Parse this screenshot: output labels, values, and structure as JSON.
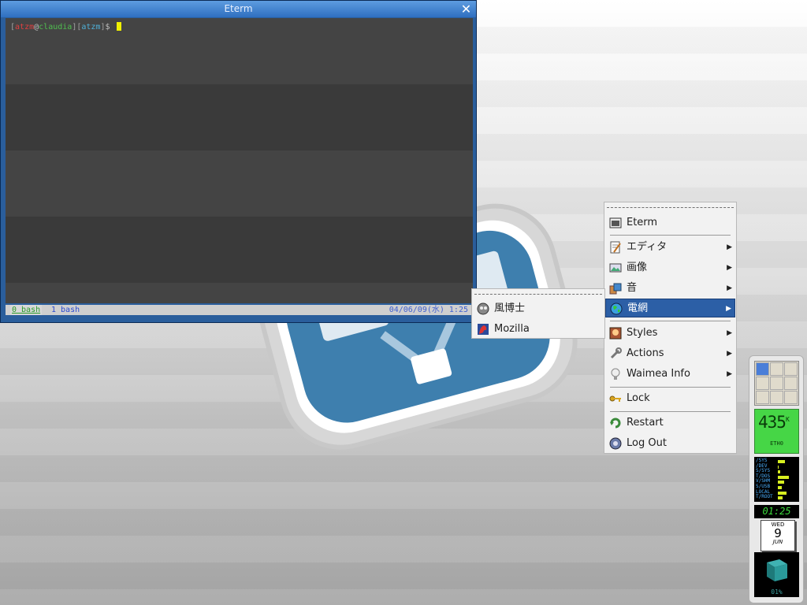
{
  "eterm": {
    "title": "Eterm",
    "prompt": {
      "open1": "[",
      "user": "atzm",
      "at": "@",
      "host": "claudia",
      "close1": "]",
      "open2": "[",
      "dir": "atzm",
      "close2": "]",
      "dollar": "$"
    },
    "status": {
      "tab0": "0 bash",
      "tab1": "1 bash",
      "datetime": "04/06/09(水) 1:25"
    }
  },
  "main_menu": {
    "items": [
      {
        "label": "Eterm",
        "icon": "terminal-icon"
      },
      {
        "label": "エディタ",
        "icon": "editor-icon",
        "submenu": true
      },
      {
        "label": "画像",
        "icon": "image-icon",
        "submenu": true
      },
      {
        "label": "音",
        "icon": "sound-icon",
        "submenu": true
      },
      {
        "label": "電網",
        "icon": "globe-icon",
        "submenu": true,
        "selected": true
      },
      {
        "label": "Styles",
        "icon": "styles-icon",
        "submenu": true
      },
      {
        "label": "Actions",
        "icon": "wrench-icon",
        "submenu": true
      },
      {
        "label": "Waimea Info",
        "icon": "lightbulb-icon",
        "submenu": true
      },
      {
        "label": "Lock",
        "icon": "key-icon"
      },
      {
        "label": "Restart",
        "icon": "restart-icon"
      },
      {
        "label": "Log Out",
        "icon": "logout-icon"
      }
    ]
  },
  "sub_menu": {
    "items": [
      {
        "label": "風博士",
        "icon": "browser-icon"
      },
      {
        "label": "Mozilla",
        "icon": "mozilla-icon"
      }
    ]
  },
  "dock": {
    "netmon": {
      "value": "435",
      "unit": "K",
      "interface": "ETH0"
    },
    "diskmon": {
      "labels": [
        "/SYS",
        "/DEV",
        "S/SYS",
        "T/DOS",
        "V/SHM",
        "S/USB",
        "LOCAL",
        "T/ROOT"
      ],
      "usage": [
        0.35,
        0.05,
        0.12,
        0.55,
        0.3,
        0.2,
        0.45,
        0.25
      ]
    },
    "clock": "01:25",
    "calendar": {
      "weekday": "WED",
      "day": "9",
      "month": "JUN"
    },
    "cpu": {
      "percent": "01%"
    }
  },
  "colors": {
    "menu_selected": "#2c5fa6",
    "titlebar": "#2f6fc0",
    "logo": "#3e7fae"
  }
}
